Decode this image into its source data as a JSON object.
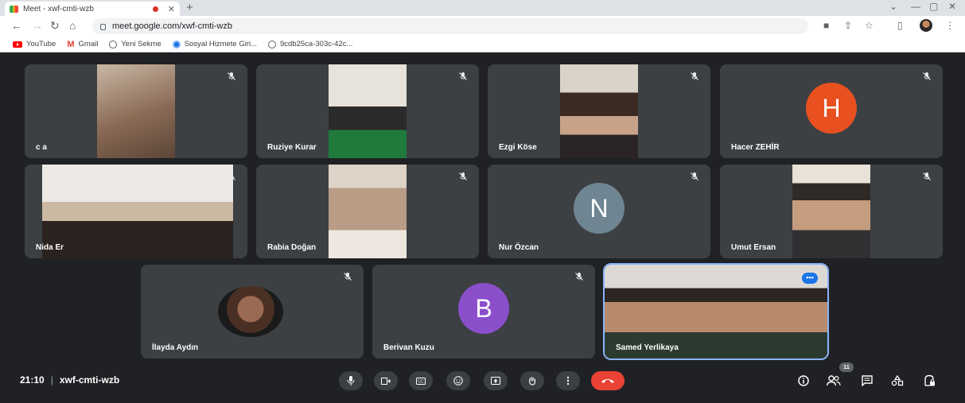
{
  "browser": {
    "tab_title": "Meet - xwf-cmti-wzb",
    "url": "meet.google.com/xwf-cmti-wzb",
    "bookmarks": [
      {
        "label": "YouTube",
        "icon": "youtube-icon"
      },
      {
        "label": "Gmail",
        "icon": "gmail-icon"
      },
      {
        "label": "Yeni Sekme",
        "icon": "globe-icon"
      },
      {
        "label": "Sosyal Hizmete Giri...",
        "icon": "blue-circle-icon"
      },
      {
        "label": "9cdb25ca-303c-42c...",
        "icon": "globe-icon"
      }
    ]
  },
  "meeting": {
    "time": "21:10",
    "code": "xwf-cmti-wzb",
    "participant_count": "11",
    "participants": [
      {
        "name": "c a",
        "kind": "video"
      },
      {
        "name": "Ruziye Kurar",
        "kind": "video"
      },
      {
        "name": "Ezgi Köse",
        "kind": "video"
      },
      {
        "name": "Hacer ZEHİR",
        "kind": "avatar",
        "initial": "H",
        "color": "#e8501f"
      },
      {
        "name": "Nida Er",
        "kind": "video"
      },
      {
        "name": "Rabia Doğan",
        "kind": "video"
      },
      {
        "name": "Nur Özcan",
        "kind": "avatar",
        "initial": "N",
        "color": "#6f8592"
      },
      {
        "name": "Umut Ersan",
        "kind": "video"
      },
      {
        "name": "İlayda Aydın",
        "kind": "video"
      },
      {
        "name": "Berivan Kuzu",
        "kind": "avatar",
        "initial": "B",
        "color": "#8b4fcc"
      },
      {
        "name": "Samed Yerlikaya",
        "kind": "video",
        "active": true
      }
    ]
  },
  "colors": {
    "background": "#202124",
    "tile": "#3c4043",
    "end_call": "#ea4335",
    "accent": "#1a73e8"
  }
}
